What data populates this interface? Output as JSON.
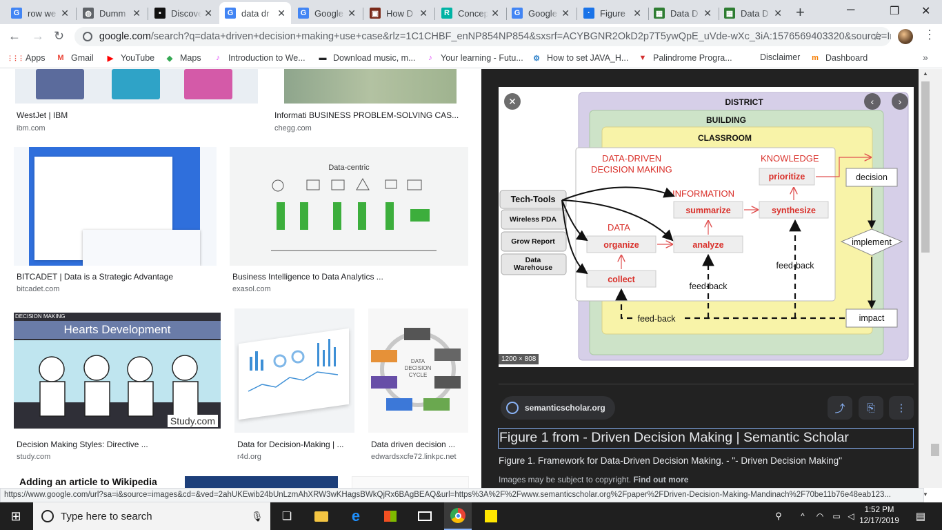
{
  "tabs": [
    {
      "title": "row we",
      "fav": "G",
      "color": "#4285f4"
    },
    {
      "title": "Dumm",
      "fav": "◍",
      "color": "#5f6368"
    },
    {
      "title": "Discove",
      "fav": "▪",
      "color": "#111111"
    },
    {
      "title": "data dr",
      "fav": "G",
      "color": "#4285f4"
    },
    {
      "title": "Google",
      "fav": "G",
      "color": "#4285f4"
    },
    {
      "title": "How D",
      "fav": "▣",
      "color": "#7a2a1a"
    },
    {
      "title": "Concep",
      "fav": "R",
      "color": "#00b3a4"
    },
    {
      "title": "Google",
      "fav": "G",
      "color": "#4285f4"
    },
    {
      "title": "Figure",
      "fav": "·",
      "color": "#1a73e8"
    },
    {
      "title": "Data D",
      "fav": "▦",
      "color": "#2e7d32"
    },
    {
      "title": "Data D",
      "fav": "▦",
      "color": "#2e7d32"
    }
  ],
  "address": {
    "domain": "google.com",
    "path": "/search?q=data+driven+decision+making+use+case&rlz=1C1CHBF_enNP854NP854&sxsrf=ACYBGNR2OkD2p7T5ywQpE_uVde-wXc_3iA:1576569403320&source=In..."
  },
  "bookmarks": [
    {
      "label": "Apps",
      "icon": "apps-grid",
      "color": "#ea4335"
    },
    {
      "label": "Gmail",
      "icon": "M",
      "color": "#ea4335"
    },
    {
      "label": "YouTube",
      "icon": "▶",
      "color": "#ff0000"
    },
    {
      "label": "Maps",
      "icon": "◆",
      "color": "#34a853"
    },
    {
      "label": "Introduction to We...",
      "icon": "♪",
      "color": "#e040fb"
    },
    {
      "label": "Download music, m...",
      "icon": "▬",
      "color": "#202124"
    },
    {
      "label": "Your learning - Futu...",
      "icon": "♪",
      "color": "#e040fb"
    },
    {
      "label": "How to set JAVA_H...",
      "icon": "⚙",
      "color": "#2a7fc9"
    },
    {
      "label": "Palindrome Progra...",
      "icon": "▼",
      "color": "#d32f2f"
    },
    {
      "label": "Disclaimer",
      "icon": "",
      "color": "#ffffff"
    },
    {
      "label": "Dashboard",
      "icon": "m",
      "color": "#f57c00"
    }
  ],
  "results": [
    {
      "caption": "WestJet | IBM",
      "source": "ibm.com"
    },
    {
      "caption": "Informati BUSINESS PROBLEM-SOLVING CAS...",
      "source": "chegg.com"
    },
    {
      "caption": "BITCADET | Data is a Strategic Advantage",
      "source": "bitcadet.com"
    },
    {
      "caption": "Business Intelligence to Data Analytics ...",
      "source": "exasol.com"
    },
    {
      "caption": "Decision Making Styles: Directive ...",
      "source": "study.com"
    },
    {
      "caption": "Data for Decision-Making | ...",
      "source": "r4d.org"
    },
    {
      "caption": "Data driven decision ...",
      "source": "edwardsxcfe72.linkpc.net"
    }
  ],
  "thumb_text": {
    "datacentric": "Data-centric",
    "dm_tag": "DECISION MAKING",
    "hearts": "Hearts Development",
    "study": "Study.com",
    "cycle": "DATA DECISION CYCLE",
    "wiki": "Adding an article to Wikipedia"
  },
  "diagram": {
    "district": "DISTRICT",
    "building": "BUILDING",
    "classroom": "CLASSROOM",
    "ddm": "DATA-DRIVEN",
    "ddm2": "DECISION MAKING",
    "knowledge": "KNOWLEDGE",
    "information": "INFORMATION",
    "data": "DATA",
    "prioritize": "prioritize",
    "summarize": "summarize",
    "synthesize": "synthesize",
    "organize": "organize",
    "analyze": "analyze",
    "collect": "collect",
    "tech_tools": "Tech-Tools",
    "wireless": "Wireless PDA",
    "grow": "Grow Report",
    "warehouse1": "Data",
    "warehouse2": "Warehouse",
    "decision": "decision",
    "implement": "implement",
    "impact": "impact",
    "feedback": "feed-back"
  },
  "viewer": {
    "dimensions": "1200 × 808",
    "source": "semanticscholar.org",
    "title": "Figure 1 from - Driven Decision Making | Semantic Scholar",
    "description": "Figure 1. Framework for Data-Driven Decision Making. - \"- Driven Decision Making\"",
    "copyright": "Images may be subject to copyright.",
    "find_out_more": "Find out more"
  },
  "status_url": "https://www.google.com/url?sa=i&source=images&cd=&ved=2ahUKEwib24bUnLzmAhXRW3wKHagsBWkQjRx6BAgBEAQ&url=https%3A%2F%2Fwww.semanticscholar.org%2Fpaper%2FDriven-Decision-Making-Mandinach%2F70be11b76e48eab123...",
  "taskbar": {
    "search_placeholder": "Type here to search",
    "time": "1:52 PM",
    "date": "12/17/2019"
  }
}
